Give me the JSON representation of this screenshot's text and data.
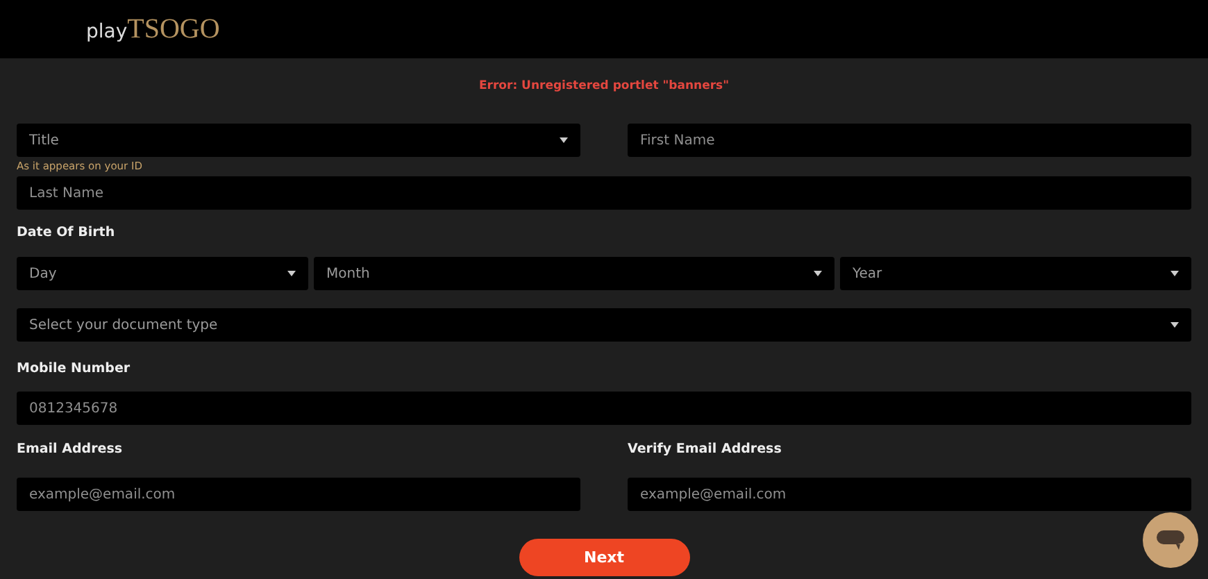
{
  "header": {
    "logo_prefix": "play",
    "logo_brand": "TSOGO"
  },
  "error": "Error: Unregistered portlet \"banners\"",
  "title_select": {
    "placeholder": "Title"
  },
  "title_hint": "As it appears on your ID",
  "first_name": {
    "placeholder": "First Name"
  },
  "last_name": {
    "placeholder": "Last Name"
  },
  "dob_label": "Date Of Birth",
  "dob_selects": [
    {
      "placeholder": "Day"
    },
    {
      "placeholder": "Month"
    },
    {
      "placeholder": "Year"
    }
  ],
  "document_select": {
    "placeholder": "Select your document type"
  },
  "mobile_label": "Mobile Number",
  "mobile": {
    "placeholder": "0812345678"
  },
  "email_label": "Email Address",
  "email": {
    "placeholder": "example@email.com"
  },
  "verify_email_label": "Verify Email Address",
  "verify_email": {
    "placeholder": "example@email.com"
  },
  "next_button": "Next"
}
